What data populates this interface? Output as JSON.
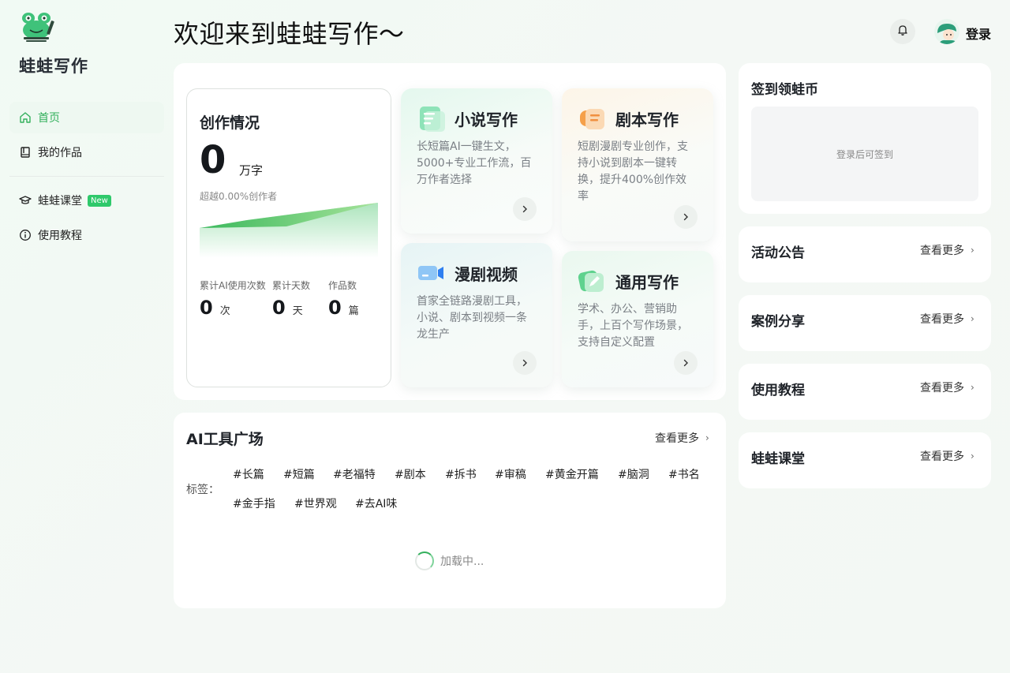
{
  "sidebar": {
    "brand": "蛙蛙写作",
    "items": [
      {
        "label": "首页",
        "icon": "home-icon",
        "active": true
      },
      {
        "label": "我的作品",
        "icon": "book-icon"
      },
      {
        "label": "蛙蛙课堂",
        "icon": "graduation-cap-icon",
        "badge": "New"
      },
      {
        "label": "使用教程",
        "icon": "info-icon"
      }
    ]
  },
  "header": {
    "title": "欢迎来到蛙蛙写作～",
    "login_label": "登录"
  },
  "stats": {
    "title": "创作情况",
    "words": "0",
    "words_unit": "万字",
    "surpass": "超越0.00%创作者",
    "ai_uses_label": "累计AI使用次数",
    "ai_uses": "0",
    "ai_uses_unit": "次",
    "days_label": "累计天数",
    "days": "0",
    "days_unit": "天",
    "works_label": "作品数",
    "works": "0",
    "works_unit": "篇"
  },
  "features": [
    {
      "title": "小说写作",
      "desc": "长短篇AI一键生文，5000+专业工作流，百万作者选择",
      "icon": "document-icon"
    },
    {
      "title": "剧本写作",
      "desc": "短剧漫剧专业创作，支持小说到剧本一键转换，提升400%创作效率",
      "icon": "script-icon"
    },
    {
      "title": "漫剧视频",
      "desc": "首家全链路漫剧工具，小说、剧本到视频一条龙生产",
      "icon": "video-camera-icon"
    },
    {
      "title": "通用写作",
      "desc": "学术、办公、营销助手，上百个写作场景，支持自定义配置",
      "icon": "edit-icon"
    }
  ],
  "tools": {
    "title": "AI工具广场",
    "more": "查看更多",
    "tags_label": "标签：",
    "tags": [
      "#长篇",
      "#短篇",
      "#老福特",
      "#剧本",
      "#拆书",
      "#审稿",
      "#黄金开篇",
      "#脑洞",
      "#书名",
      "#金手指",
      "#世界观",
      "#去AI味"
    ],
    "loading": "加载中..."
  },
  "right": {
    "signin_title": "签到领蛙币",
    "signin_hint": "登录后可签到",
    "sections": [
      {
        "title": "活动公告",
        "more": "查看更多"
      },
      {
        "title": "案例分享",
        "more": "查看更多"
      },
      {
        "title": "使用教程",
        "more": "查看更多"
      },
      {
        "title": "蛙蛙课堂",
        "more": "查看更多"
      }
    ]
  },
  "colors": {
    "accent": "#33b05c",
    "badge": "#2fc96b"
  }
}
